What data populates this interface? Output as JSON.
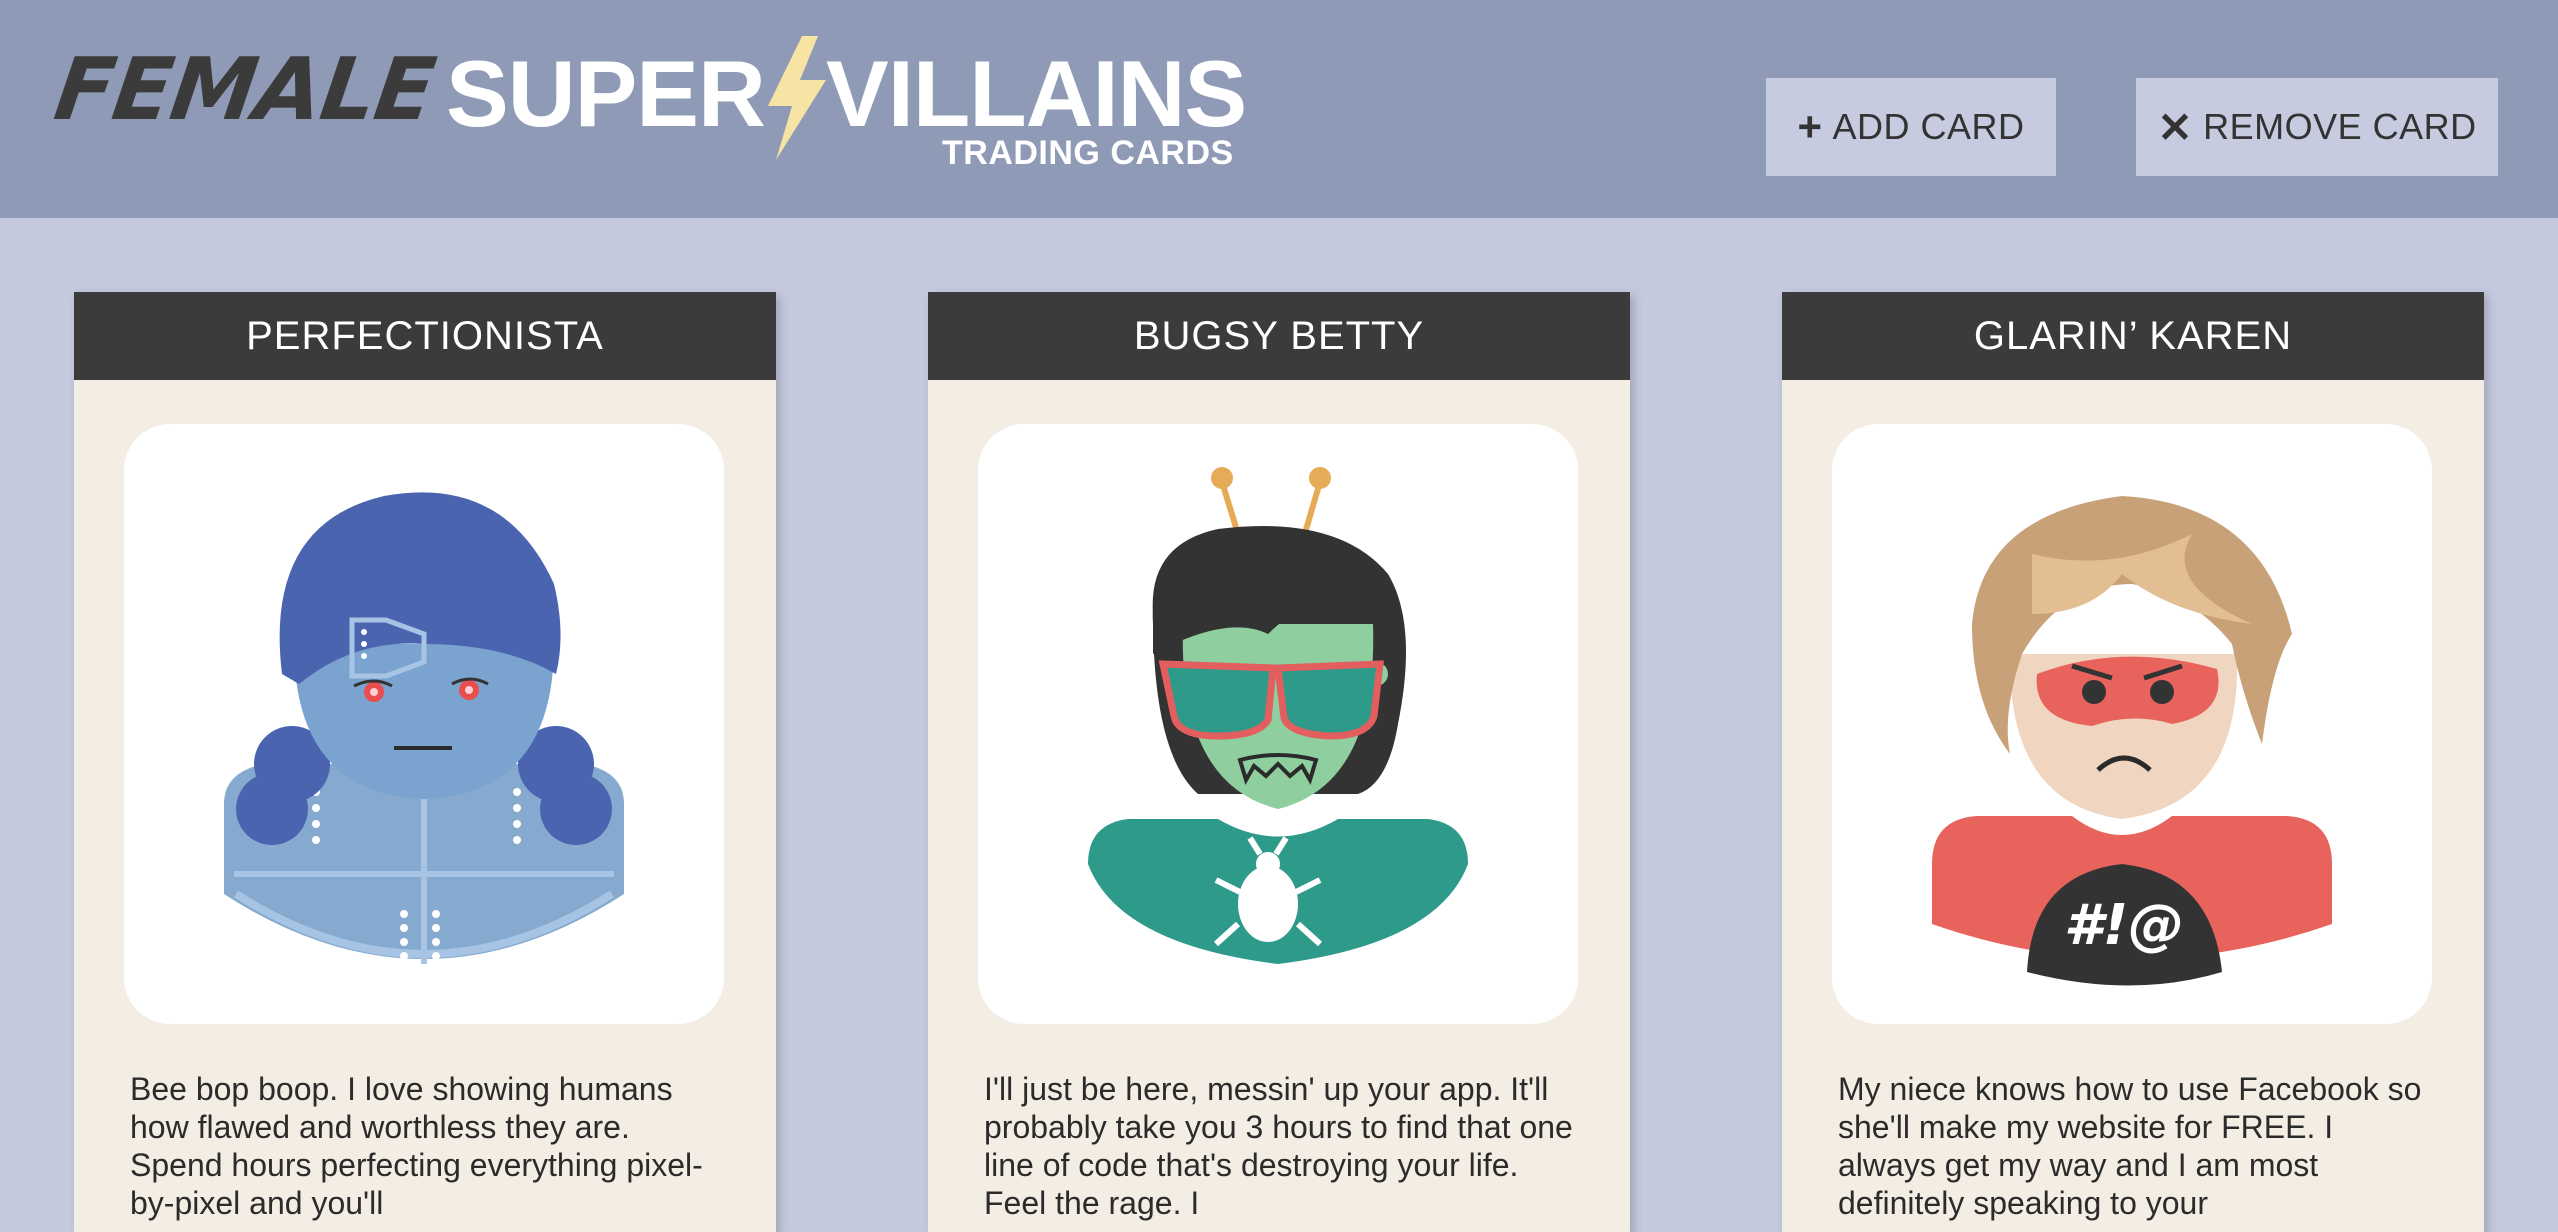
{
  "header": {
    "logo_word1": "FEMALE",
    "logo_word2": "SUPER",
    "logo_word3": "VILLAINS",
    "logo_sub": "TRADING CARDS",
    "add_label": "ADD CARD",
    "remove_label": "REMOVE CARD"
  },
  "colors": {
    "header_bg": "#8f9ab6",
    "page_bg": "#c4c9dd",
    "card_bg": "#f3ede3",
    "card_title_bg": "#3b3b3b",
    "bolt": "#f7e3a3"
  },
  "cards": [
    {
      "title": "PERFECTIONISTA",
      "description": "Bee bop boop. I love showing humans how flawed and worthless they are. Spend hours perfecting everything pixel-by-pixel and you'll"
    },
    {
      "title": "BUGSY BETTY",
      "description": "I'll just be here, messin' up your app. It'll probably take you 3 hours to find that one line of code that's destroying your life. Feel the rage. I"
    },
    {
      "title": "GLARIN’ KAREN",
      "description": "My niece knows how to use Facebook so she'll make my website for FREE. I always get my way and I am most definitely speaking to your",
      "shirt_text": "#!@"
    }
  ]
}
